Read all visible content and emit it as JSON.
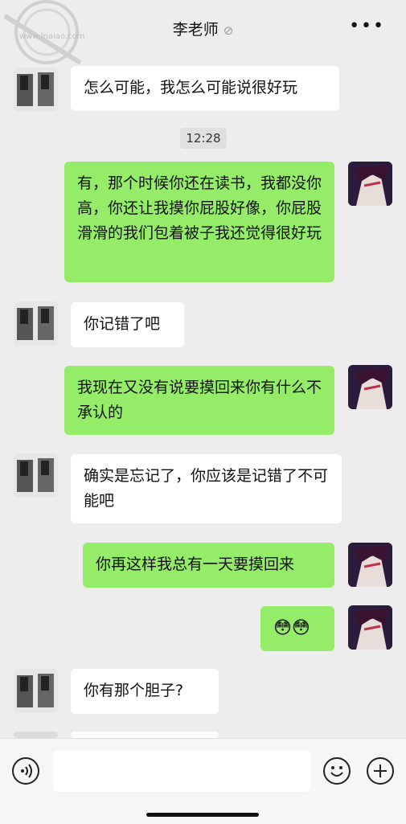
{
  "header": {
    "title": "李老师",
    "more_label": "•••"
  },
  "timestamp": "12:28",
  "messages": [
    {
      "side": "left",
      "text": "怎么可能，我怎么可能说很好玩"
    },
    {
      "side": "right",
      "text": "有，那个时候你还在读书，我都没你高，你还让我摸你屁股好像，你屁股滑滑的我们包着被子我还觉得很好玩"
    },
    {
      "side": "left",
      "text": "你记错了吧"
    },
    {
      "side": "right",
      "text": "我现在又没有说要摸回来你有什么不承认的"
    },
    {
      "side": "left",
      "text": "确实是忘记了，你应该是记错了不可能吧"
    },
    {
      "side": "right",
      "text": "你再这样我总有一天要摸回来"
    },
    {
      "side": "right",
      "text": "😳😳"
    },
    {
      "side": "left",
      "text": "你有那个胆子?"
    }
  ],
  "watermark_text": "www.lnaiao.com"
}
